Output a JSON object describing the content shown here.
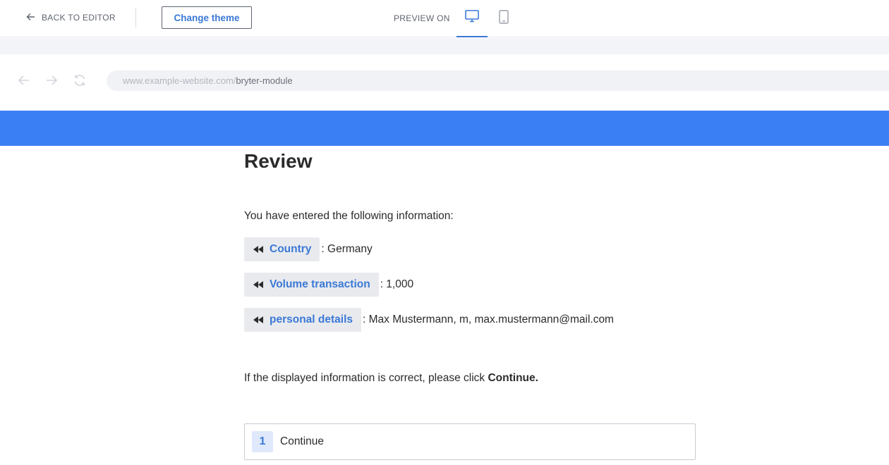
{
  "toolbar": {
    "back_label": "BACK TO EDITOR",
    "theme_button": "Change theme",
    "preview_label": "PREVIEW ON",
    "active_device": "desktop",
    "accent": "#3a79d6"
  },
  "browser": {
    "url_domain": "www.example-website.com/",
    "url_path": "bryter-module",
    "header_color": "#3b7ff5"
  },
  "page": {
    "title": "Review",
    "intro": "You have entered the following information:",
    "entries": [
      {
        "label": "Country",
        "value": ": Germany"
      },
      {
        "label": "Volume transaction",
        "value": ": 1,000"
      },
      {
        "label": "personal details",
        "value": ": Max Mustermann, m, max.mustermann@mail.com"
      }
    ],
    "confirm_text": "If the displayed information is correct, please click ",
    "confirm_bold": "Continue.",
    "option": {
      "number": "1",
      "label": "Continue"
    }
  }
}
